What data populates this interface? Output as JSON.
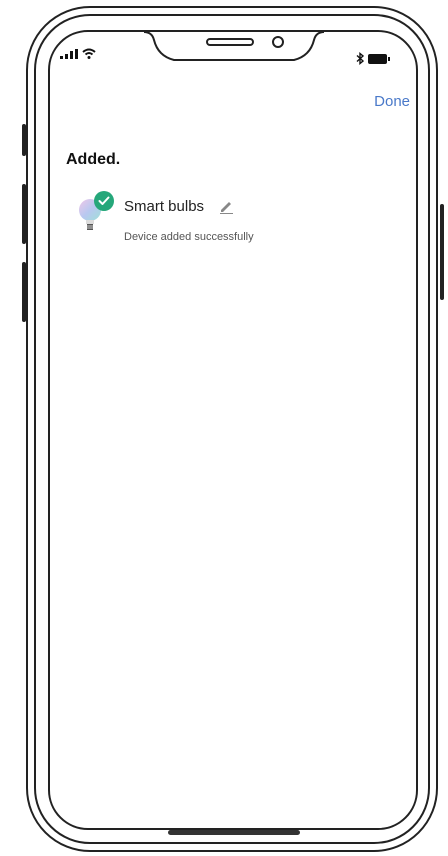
{
  "navbar": {
    "done_label": "Done"
  },
  "main": {
    "section_title": "Added.",
    "devices": [
      {
        "name": "Smart bulbs",
        "status": "Device added successfully",
        "icon": "smart-bulb-icon",
        "badge_icon": "check-icon"
      }
    ]
  },
  "colors": {
    "accent": "#4a79c9",
    "success": "#25a77a"
  }
}
